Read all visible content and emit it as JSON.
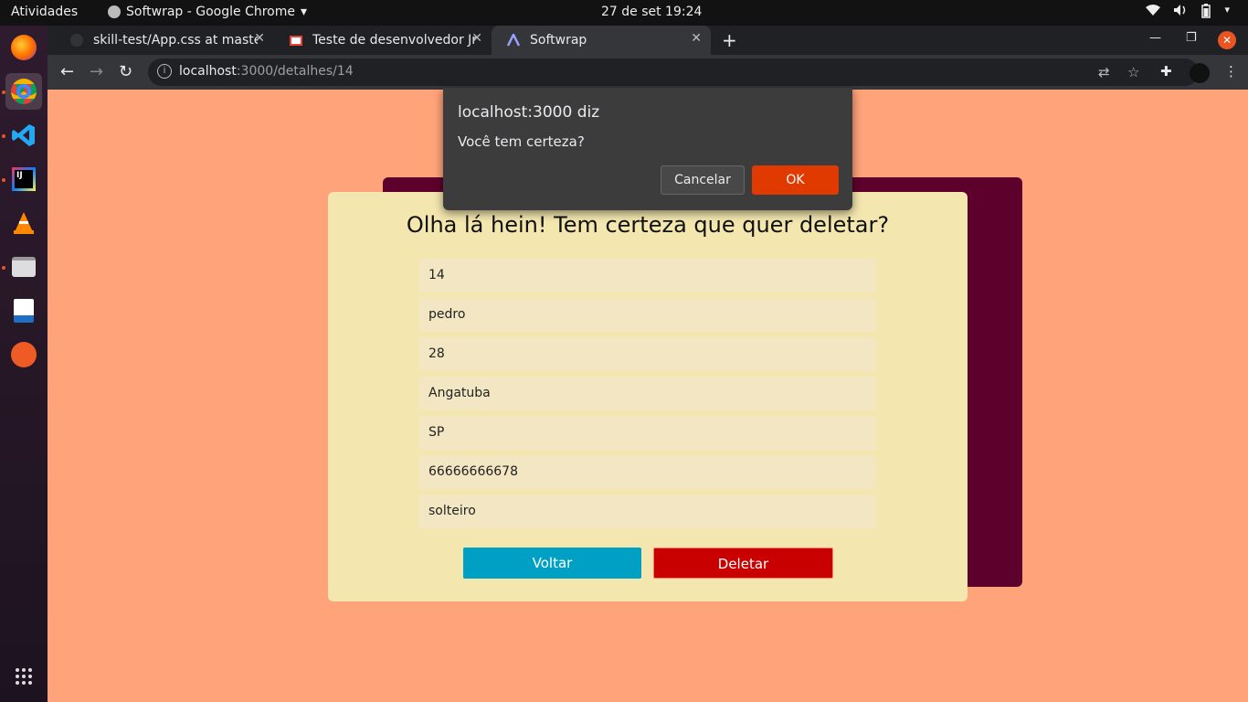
{
  "topbar": {
    "activities": "Atividades",
    "app_name": "Softwrap - Google Chrome",
    "app_arrow": "▾",
    "clock": "27 de set  19:24",
    "tray": [
      "wifi-icon",
      "volume-icon",
      "battery-icon",
      "power-icon"
    ]
  },
  "browser": {
    "tabs": [
      {
        "label": "skill-test/App.css at master",
        "icon": "github-icon"
      },
      {
        "label": "Teste de desenvolvedor Jr",
        "icon": "gmail-icon"
      },
      {
        "label": "Softwrap",
        "icon": "softwrap-icon",
        "active": true
      }
    ],
    "url_host": "localhost",
    "url_rest": ":3000/detalhes/14"
  },
  "page": {
    "title": "Olha lá hein! Tem certeza que quer deletar?",
    "fields": [
      "14",
      "pedro",
      "28",
      "Angatuba",
      "SP",
      "66666666678",
      "solteiro"
    ],
    "back_label": "Voltar",
    "delete_label": "Deletar"
  },
  "dialog": {
    "title": "localhost:3000 diz",
    "message": "Você tem certeza?",
    "cancel_label": "Cancelar",
    "ok_label": "OK"
  },
  "colors": {
    "page_bg": "#FFA37A",
    "card_bg": "#F3E6AE",
    "back_card": "#5E002C",
    "back_button": "#00A0C4",
    "delete_button": "#C90000",
    "ok_button": "#E03A00"
  }
}
